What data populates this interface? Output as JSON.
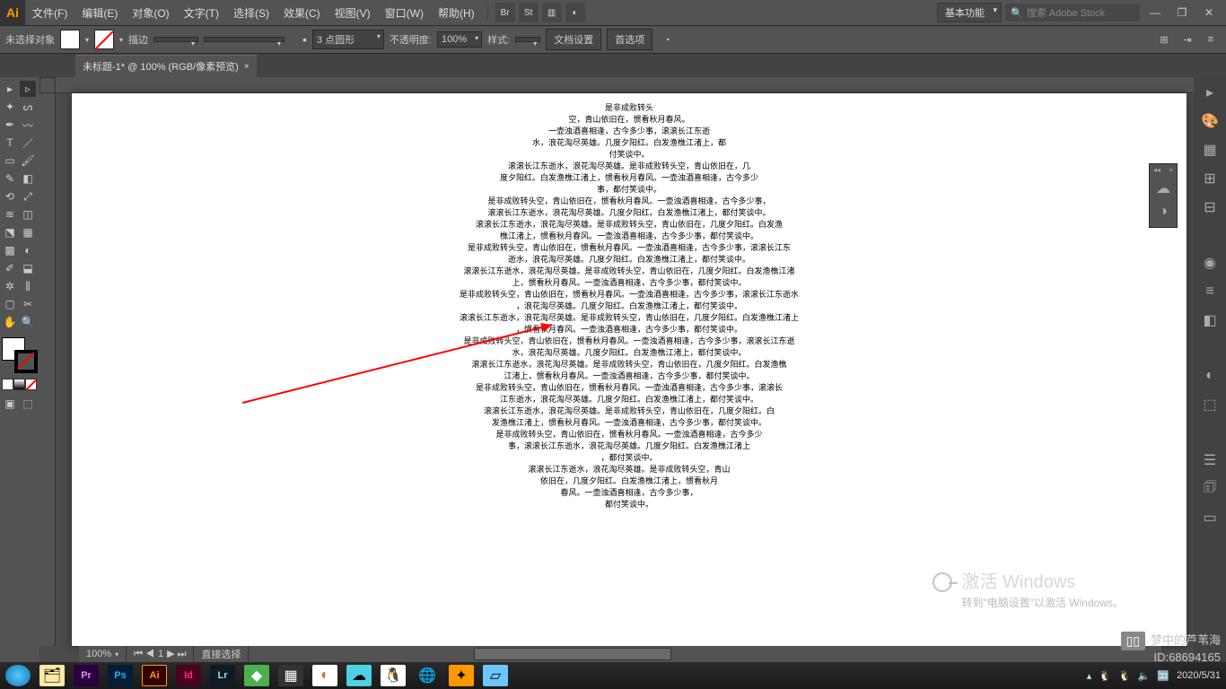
{
  "menubar": {
    "items": [
      "文件(F)",
      "编辑(E)",
      "对象(O)",
      "文字(T)",
      "选择(S)",
      "效果(C)",
      "视图(V)",
      "窗口(W)",
      "帮助(H)"
    ],
    "workspace": "基本功能",
    "search_placeholder": "搜索 Adobe Stock"
  },
  "ctrlbar": {
    "no_selection": "未选择对象",
    "stroke_label": "描边",
    "stroke_width": "",
    "brush_width": "3 点圆形",
    "opacity_label": "不透明度:",
    "opacity_value": "100%",
    "style_label": "样式:",
    "doc_setup": "文档设置",
    "prefs": "首选项"
  },
  "tab": {
    "title": "未标题-1* @ 100% (RGB/像素预览)"
  },
  "status": {
    "zoom": "100%",
    "nav_art": "1",
    "tool": "直接选择"
  },
  "watermark": {
    "line1": "激活 Windows",
    "line2": "转到\"电脑设置\"以激活 Windows。"
  },
  "corner": {
    "l1": "梦中的芦苇海",
    "l2": "ID:68694165"
  },
  "taskbar": {
    "date": "2020/5/31"
  },
  "poem_lines": [
    "是非成败转头",
    "空，青山依旧在，惯看秋月春风。",
    "一壶浊酒喜相逢，古今多少事，滚滚长江东逝",
    "水，浪花淘尽英雄。几度夕阳红。白发渔樵江渚上，都",
    "付笑谈中。",
    "滚滚长江东逝水，浪花淘尽英雄。是非成败转头空，青山依旧在，几",
    "度夕阳红。白发渔樵江渚上，惯看秋月春风。一壶浊酒喜相逢，古今多少",
    "事，都付笑谈中。",
    "是非成败转头空，青山依旧在，惯看秋月春风。一壶浊酒喜相逢，古今多少事，",
    "滚滚长江东逝水，浪花淘尽英雄。几度夕阳红。白发渔樵江渚上，都付笑谈中。",
    "滚滚长江东逝水，浪花淘尽英雄。是非成败转头空，青山依旧在，几度夕阳红。白发渔",
    "樵江渚上，惯看秋月春风。一壶浊酒喜相逢，古今多少事，都付笑谈中。",
    "是非成败转头空，青山依旧在，惯看秋月春风。一壶浊酒喜相逢，古今多少事，滚滚长江东",
    "逝水，浪花淘尽英雄。几度夕阳红。白发渔樵江渚上，都付笑谈中。",
    "滚滚长江东逝水，浪花淘尽英雄。是非成败转头空，青山依旧在，几度夕阳红。白发渔樵江渚",
    "上，惯看秋月春风。一壶浊酒喜相逢，古今多少事，都付笑谈中。",
    "是非成败转头空，青山依旧在，惯看秋月春风。一壶浊酒喜相逢，古今多少事，滚滚长江东逝水",
    "，浪花淘尽英雄。几度夕阳红。白发渔樵江渚上，都付笑谈中。",
    "滚滚长江东逝水，浪花淘尽英雄。是非成败转头空，青山依旧在，几度夕阳红。白发渔樵江渚上",
    "，惯看秋月春风。一壶浊酒喜相逢，古今多少事，都付笑谈中。",
    "是非成败转头空，青山依旧在，惯看秋月春风。一壶浊酒喜相逢，古今多少事，滚滚长江东逝",
    "水，浪花淘尽英雄。几度夕阳红。白发渔樵江渚上，都付笑谈中。",
    "滚滚长江东逝水，浪花淘尽英雄。是非成败转头空，青山依旧在，几度夕阳红。白发渔樵",
    "江渚上，惯看秋月春风。一壶浊酒喜相逢，古今多少事，都付笑谈中。",
    "是非成败转头空，青山依旧在，惯看秋月春风。一壶浊酒喜相逢，古今多少事，滚滚长",
    "江东逝水，浪花淘尽英雄。几度夕阳红。白发渔樵江渚上，都付笑谈中。",
    "滚滚长江东逝水，浪花淘尽英雄。是非成败转头空，青山依旧在，几度夕阳红。白",
    "发渔樵江渚上，惯看秋月春风。一壶浊酒喜相逢，古今多少事，都付笑谈中。",
    "是非成败转头空，青山依旧在，惯看秋月春风。一壶浊酒喜相逢，古今多少",
    "事，滚滚长江东逝水，浪花淘尽英雄。几度夕阳红。白发渔樵江渚上",
    "，都付笑谈中。",
    "滚滚长江东逝水，浪花淘尽英雄。是非成败转头空，青山",
    "依旧在，几度夕阳红。白发渔樵江渚上，惯看秋月",
    "春风。一壶浊酒喜相逢，古今多少事，",
    "都付笑谈中。"
  ]
}
